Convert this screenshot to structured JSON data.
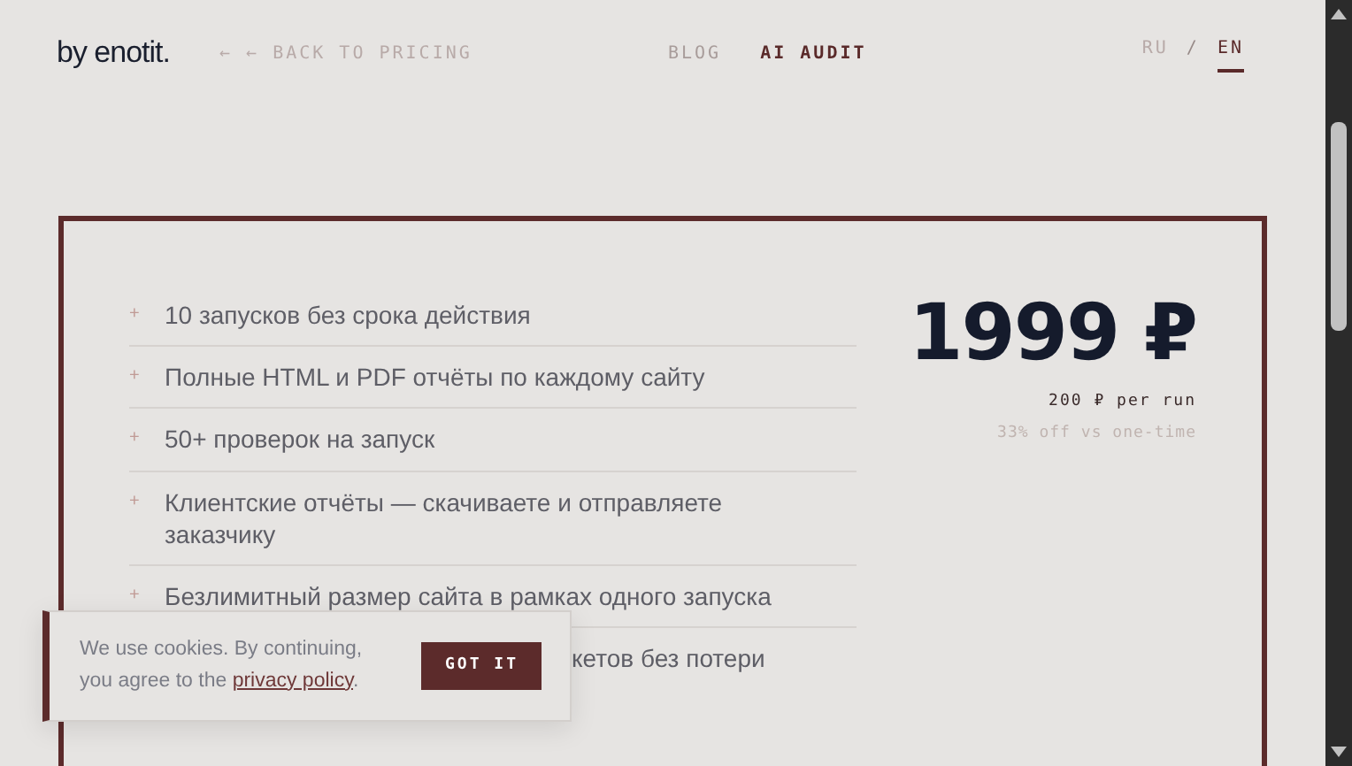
{
  "header": {
    "logo": "by enotit.",
    "back_link": "← ← BACK TO PRICING",
    "nav": [
      {
        "label": "BLOG",
        "selected": false
      },
      {
        "label": "AI AUDIT",
        "selected": true
      }
    ],
    "languages": [
      {
        "label": "RU",
        "selected": false
      },
      {
        "label": "EN",
        "selected": true
      }
    ],
    "language_separator": "/"
  },
  "plan": {
    "features": [
      {
        "marker": "+",
        "text": "10 запусков без срока действия",
        "kind": "full"
      },
      {
        "marker": "+",
        "text": "Полные HTML и PDF отчёты по каждому сайту",
        "kind": "full"
      },
      {
        "marker": "+",
        "text": "50+ проверок на запуск",
        "kind": "full"
      },
      {
        "marker": "+",
        "text": "Клиентские отчёты — скачиваете и отправляете заказчику",
        "kind": "full"
      },
      {
        "marker": "+",
        "text": "Безлимитный размер сайта в рамках одного запуска",
        "kind": "full"
      },
      {
        "text": "кетов без потери",
        "kind": "covered"
      }
    ],
    "price": "1999 ₽",
    "per_run": "200 ₽ per run",
    "discount": "33% off vs one-time"
  },
  "cookie_banner": {
    "text_before": "We use cookies. By continuing, you agree to the ",
    "link": "privacy policy",
    "text_after": ".",
    "button": "GOT IT"
  }
}
